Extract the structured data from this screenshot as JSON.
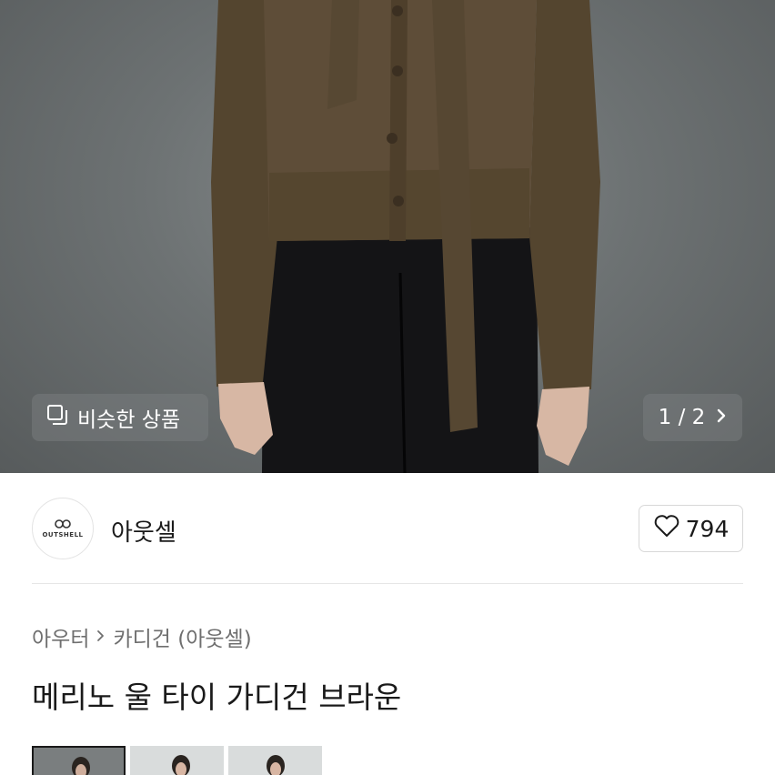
{
  "hero": {
    "similar_label": "비슷한 상품",
    "similar_icon": "copy-icon",
    "pager": "1 / 2",
    "pager_icon": "chevron-right-icon"
  },
  "seller": {
    "logo_text": "OUTSHELL",
    "name": "아웃셀",
    "like_icon": "heart-icon",
    "likes": "794"
  },
  "breadcrumb": {
    "level1": "아우터",
    "separator_icon": "chevron-right-icon",
    "level2": "카디건 (아웃셀)"
  },
  "product": {
    "title": "메리노 울 타이 가디건 브라운"
  },
  "thumbnails": [
    {
      "selected": true
    },
    {
      "selected": false
    },
    {
      "selected": false
    }
  ],
  "colors": {
    "cardigan": "#5a4a36",
    "pants": "#141416",
    "background": "#6f7475"
  }
}
